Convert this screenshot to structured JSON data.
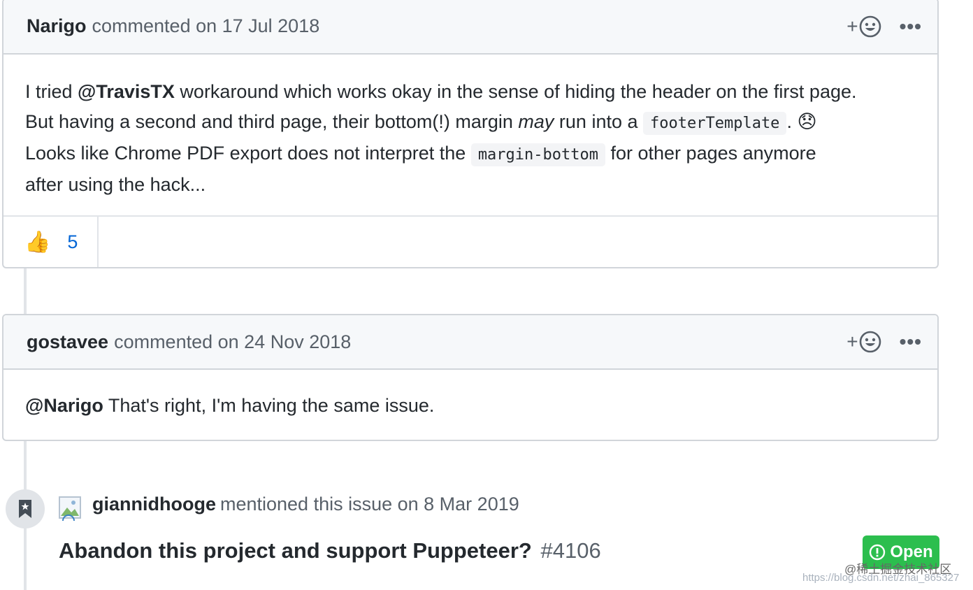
{
  "comments": [
    {
      "author": "Narigo",
      "meta": "commented on 17 Jul 2018",
      "body": {
        "p1": "I tried ",
        "mention": "@TravisTX",
        "p2": " workaround which works okay in the sense of hiding the header on the first page.",
        "p3": "But having a second and third page, their bottom(!) margin ",
        "em": "may",
        "p4": " run into a ",
        "code1": "footerTemplate",
        "p5": ". ",
        "emoji": "😞",
        "p6": "Looks like Chrome PDF export does not interpret the ",
        "code2": "margin-bottom",
        "p7": " for other pages anymore",
        "p8": "after using the hack..."
      },
      "reactions": [
        {
          "emoji": "👍",
          "count": "5"
        }
      ]
    },
    {
      "author": "gostavee",
      "meta": "commented on 24 Nov 2018",
      "body": {
        "mention": "@Narigo",
        "text": " That's right, I'm having the same issue."
      }
    }
  ],
  "header_actions": {
    "add_reaction_icon": "smiley-plus-icon",
    "more_icon": "kebab-horizontal-icon"
  },
  "event": {
    "icon": "bookmark-icon",
    "author": "giannidhooge",
    "text": "mentioned this issue on 8 Mar 2019",
    "issue_title": "Abandon this project and support Puppeteer?",
    "issue_number": "#4106",
    "status": "Open",
    "status_color": "#2cbe4e"
  },
  "watermark": {
    "line1": "@稀土掘金技术社区",
    "line2": "https://blog.csdn.net/zhai_865327"
  },
  "colors": {
    "link": "#0366d6",
    "border": "#d1d5da",
    "header_bg": "#f6f8fa"
  }
}
